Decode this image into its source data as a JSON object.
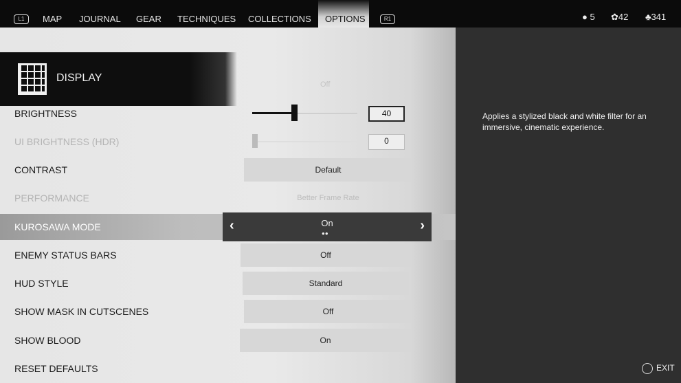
{
  "nav": {
    "left_button": "L1",
    "right_button": "R1",
    "tabs": [
      "MAP",
      "JOURNAL",
      "GEAR",
      "TECHNIQUES",
      "COLLECTIONS",
      "OPTIONS"
    ],
    "active": "OPTIONS"
  },
  "currency": [
    {
      "icon": "resolve-icon",
      "value": "5"
    },
    {
      "icon": "flower-icon",
      "value": "42"
    },
    {
      "icon": "supplies-icon",
      "value": "341"
    }
  ],
  "section": {
    "title": "DISPLAY",
    "hidden_row_value": "Off"
  },
  "settings": [
    {
      "label": "BRIGHTNESS",
      "type": "slider",
      "value": "40",
      "level": 0.4
    },
    {
      "label": "UI BRIGHTNESS (HDR)",
      "type": "slider",
      "value": "0",
      "level": 0,
      "disabled": true
    },
    {
      "label": "CONTRAST",
      "value": "Default"
    },
    {
      "label": "PERFORMANCE",
      "value": "Better Frame Rate",
      "disabled": true
    },
    {
      "label": "KUROSAWA MODE",
      "value": "On",
      "selected": true
    },
    {
      "label": "ENEMY STATUS BARS",
      "value": "Off"
    },
    {
      "label": "HUD STYLE",
      "value": "Standard"
    },
    {
      "label": "SHOW MASK IN CUTSCENES",
      "value": "Off"
    },
    {
      "label": "SHOW BLOOD",
      "value": "On"
    },
    {
      "label": "RESET DEFAULTS"
    }
  ],
  "description": "Applies a stylized black and white filter for an immersive, cinematic experience.",
  "footer": {
    "exit_label": "EXIT"
  }
}
